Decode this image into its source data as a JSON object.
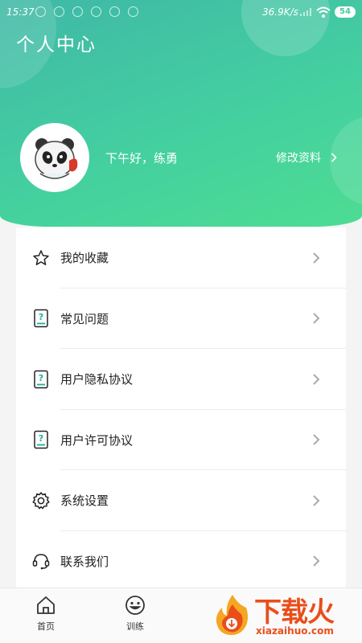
{
  "status_bar": {
    "time": "15:37",
    "network_speed": "36.9K/s",
    "battery": "54"
  },
  "header": {
    "title": "个人中心",
    "greeting": "下午好，练勇",
    "edit_profile_label": "修改资料"
  },
  "menu": {
    "items": [
      {
        "label": "我的收藏",
        "icon": "star-icon"
      },
      {
        "label": "常见问题",
        "icon": "question-doc-icon"
      },
      {
        "label": "用户隐私协议",
        "icon": "question-doc-icon"
      },
      {
        "label": "用户许可协议",
        "icon": "question-doc-icon"
      },
      {
        "label": "系统设置",
        "icon": "gear-icon"
      },
      {
        "label": "联系我们",
        "icon": "headset-icon"
      }
    ]
  },
  "tab_bar": {
    "tabs": [
      {
        "label": "首页",
        "icon": "home-icon"
      },
      {
        "label": "训练",
        "icon": "smiley-icon"
      }
    ]
  },
  "watermark": {
    "text": "下载火",
    "url": "xiazaihuo.com"
  },
  "colors": {
    "header_gradient_start": "#3fb8a7",
    "header_gradient_end": "#4ddc92",
    "icon_accent": "#1fae96",
    "watermark": "#e94e1b"
  }
}
